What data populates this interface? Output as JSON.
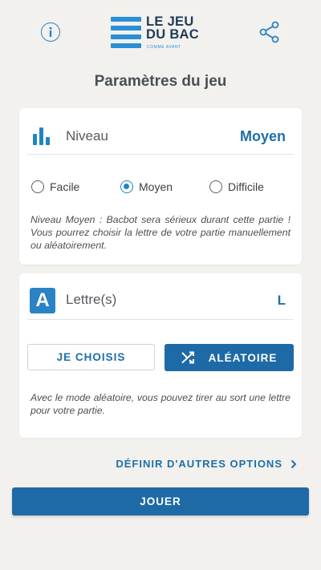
{
  "header": {
    "logo_line1": "LE JEU",
    "logo_line2": "DU BAC",
    "logo_tagline": "COMME AVANT",
    "info_icon": "info-icon",
    "share_icon": "share-icon"
  },
  "page": {
    "title": "Paramètres du jeu"
  },
  "level": {
    "label": "Niveau",
    "value": "Moyen",
    "icon": "bar-chart-icon",
    "options": [
      {
        "label": "Facile",
        "checked": false
      },
      {
        "label": "Moyen",
        "checked": true
      },
      {
        "label": "Difficile",
        "checked": false
      }
    ],
    "description": "Niveau Moyen : Bacbot sera sérieux durant cette partie ! Vous pourrez choisir la lettre de votre partie manuellement ou aléatoirement."
  },
  "letter": {
    "label": "Lettre(s)",
    "value": "L",
    "icon_letter": "A",
    "choose_label": "JE CHOISIS",
    "random_label": "ALÉATOIRE",
    "random_icon": "shuffle-icon",
    "description": "Avec le mode aléatoire, vous pouvez tirer au sort une lettre pour votre partie."
  },
  "actions": {
    "more_options": "DÉFINIR D'AUTRES OPTIONS",
    "play": "JOUER"
  },
  "colors": {
    "accent": "#1d6aa6",
    "brand_blue": "#2a8fd6",
    "background": "#f2f1ee"
  }
}
